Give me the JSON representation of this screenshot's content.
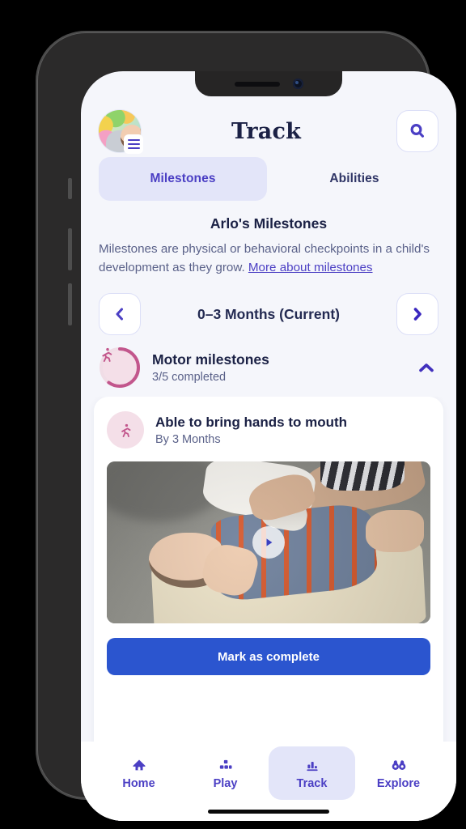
{
  "header": {
    "title": "Track",
    "avatar_name": "child-avatar",
    "menu_badge_icon": "hamburger-menu-icon",
    "search_icon": "search-icon"
  },
  "tabs": [
    {
      "label": "Milestones",
      "active": true
    },
    {
      "label": "Abilities",
      "active": false
    }
  ],
  "intro": {
    "title": "Arlo's Milestones",
    "body": "Milestones are physical or behavioral checkpoints in a child's development as they grow. ",
    "link": "More about milestones"
  },
  "age_nav": {
    "prev_icon": "chevron-left-icon",
    "next_icon": "chevron-right-icon",
    "label": "0–3 Months (Current)"
  },
  "category": {
    "icon": "motor-activity-icon",
    "name": "Motor milestones",
    "progress": "3/5 completed",
    "completed": 3,
    "total": 5,
    "percent": 60,
    "collapse_icon": "chevron-up-icon",
    "expanded": true
  },
  "milestone_card": {
    "icon": "motor-activity-icon",
    "title": "Able to bring hands to mouth",
    "subtitle": "By 3 Months",
    "video": {
      "play_icon": "play-icon",
      "alt": "Baby lying on back bringing hands to mouth"
    },
    "primary_button": "Mark as complete"
  },
  "bottom_nav": [
    {
      "label": "Home",
      "icon": "home-icon",
      "active": false
    },
    {
      "label": "Play",
      "icon": "blocks-icon",
      "active": false
    },
    {
      "label": "Track",
      "icon": "bar-chart-icon",
      "active": true
    },
    {
      "label": "Explore",
      "icon": "binoculars-icon",
      "active": false
    }
  ],
  "colors": {
    "accent_purple": "#4b3fc4",
    "accent_lavender": "#e3e5f9",
    "screen_bg": "#f5f6fb",
    "text_dark": "#1b2145",
    "text_muted": "#5a6189",
    "progress_pink": "#c2568c",
    "progress_track": "#f4dfe8",
    "primary_blue": "#2b55cf"
  }
}
